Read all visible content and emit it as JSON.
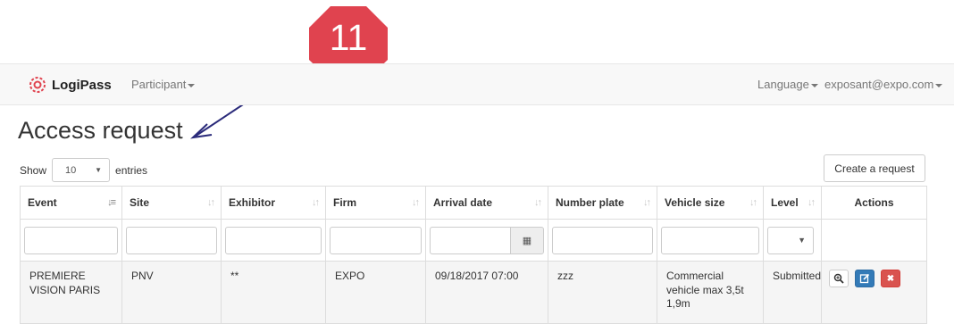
{
  "annotation": {
    "step_number": "11",
    "badge_color": "#e0434f",
    "arrow_color": "#2a2a7a"
  },
  "navbar": {
    "brand": "LogiPass",
    "participant_menu": "Participant",
    "language_menu": "Language",
    "user_menu": "exposant@expo.com"
  },
  "page": {
    "title": "Access request",
    "show_label": "Show",
    "page_size": "10",
    "entries_label": "entries",
    "create_button": "Create a request"
  },
  "table": {
    "columns": [
      "Event",
      "Site",
      "Exhibitor",
      "Firm",
      "Arrival date",
      "Number plate",
      "Vehicle size",
      "Level",
      "Actions"
    ],
    "rows": [
      {
        "event": "PREMIERE VISION PARIS",
        "site": "PNV",
        "exhibitor": "**",
        "firm": "EXPO",
        "arrival_date": "09/18/2017 07:00",
        "number_plate": "zzz",
        "vehicle_size": "Commercial vehicle max 3,5t 1,9m",
        "level": "Submitted"
      }
    ]
  },
  "icons": {
    "view": "zoom-in-icon",
    "edit": "edit-icon",
    "delete": "delete-icon",
    "calendar": "calendar-icon"
  }
}
